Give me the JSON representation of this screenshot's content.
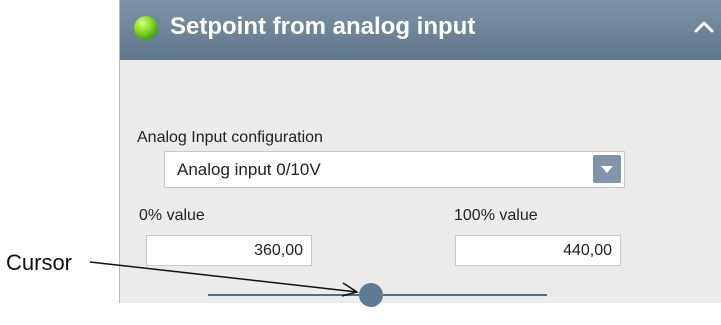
{
  "panel": {
    "title": "Setpoint from analog input",
    "status_color": "#6acb25",
    "header_color": "#6d849a",
    "accent_color": "#7f95a9"
  },
  "analog_config": {
    "label": "Analog Input configuration",
    "selected": "Analog input 0/10V"
  },
  "range": {
    "min_label": "0% value",
    "min_value": "360,00",
    "max_label": "100% value",
    "max_value": "440,00"
  },
  "slider": {
    "position_fraction": 0.48
  },
  "annotation": {
    "label": "Cursor"
  }
}
